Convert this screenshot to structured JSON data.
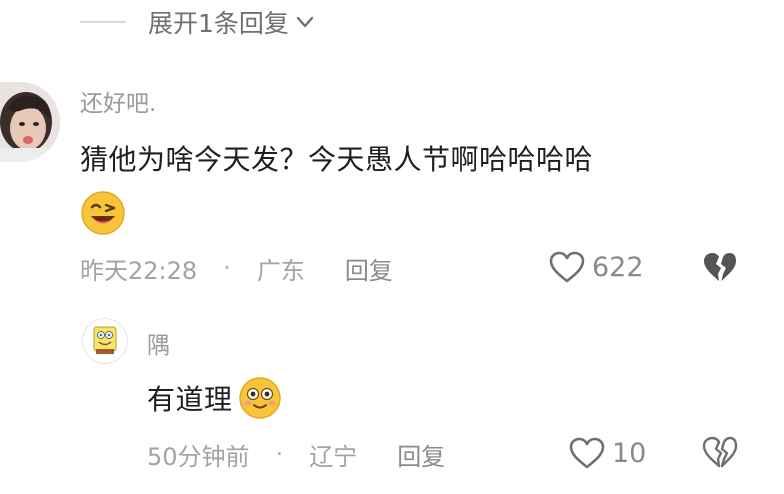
{
  "expand_replies": {
    "label": "展开1条回复"
  },
  "comments": [
    {
      "username": "还好吧.",
      "text": "猜他为啥今天发？今天愚人节啊哈哈哈哈",
      "emoji": "grinning-wink-emoji",
      "time": "昨天22:28",
      "dot": "·",
      "location": "广东",
      "reply_label": "回复",
      "likes": "622"
    }
  ],
  "reply": {
    "username": "隅",
    "text": "有道理",
    "emoji": "flushed-smile-emoji",
    "time": "50分钟前",
    "dot": "·",
    "location": "辽宁",
    "reply_label": "回复",
    "likes": "10"
  },
  "icons": {
    "expand": "chevron-down-icon",
    "like": "heart-outline-icon",
    "dislike": "broken-heart-icon"
  },
  "colors": {
    "text_primary": "#1f1f1f",
    "text_secondary": "#a3a3a3",
    "emoji_yellow": "#f7c43a"
  }
}
